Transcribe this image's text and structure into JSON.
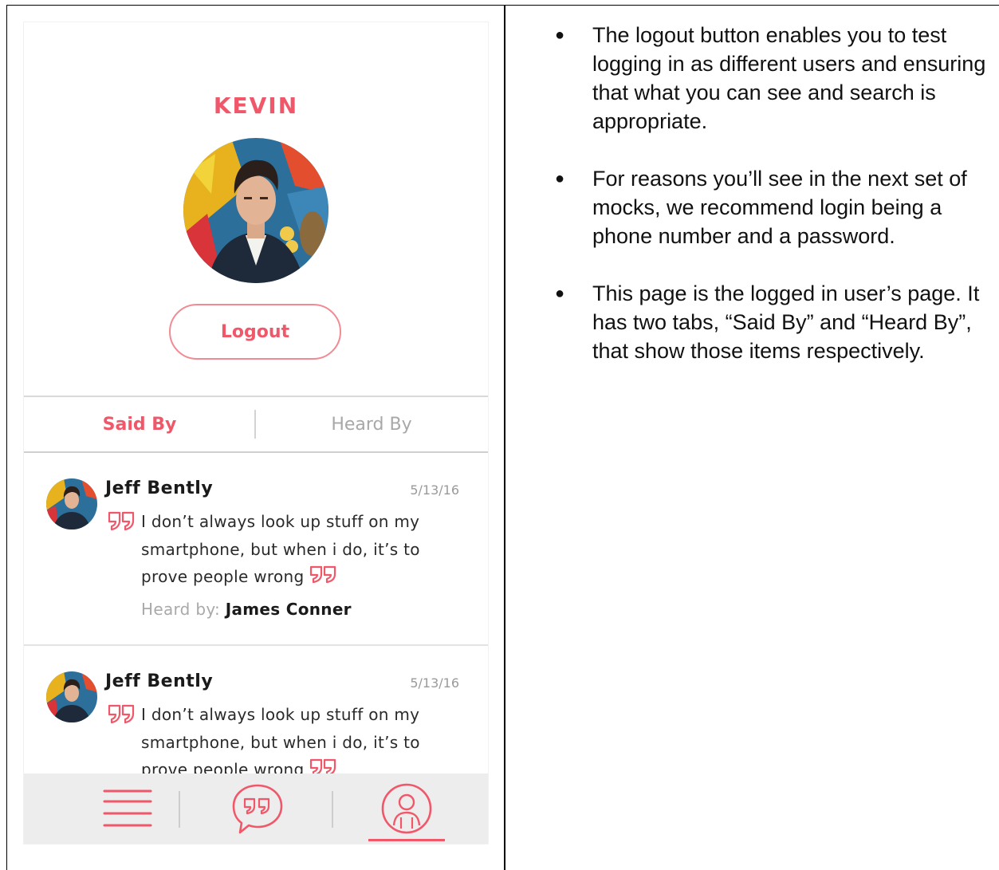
{
  "profile": {
    "name": "KEVIN",
    "logout_label": "Logout"
  },
  "tabs": [
    {
      "label": "Said By",
      "active": true
    },
    {
      "label": "Heard By",
      "active": false
    }
  ],
  "feed": [
    {
      "author": "Jeff Bently",
      "date": "5/13/16",
      "quote": "I don’t always look up stuff on my smartphone, but when i do, it’s to prove people wrong",
      "heard_by_label": "Heard by:",
      "heard_by_name": "James Conner"
    },
    {
      "author": "Jeff Bently",
      "date": "5/13/16",
      "quote": "I don’t always look up stuff on my smartphone, but when i do, it’s to prove people wrong"
    }
  ],
  "bottom_nav": {
    "items": [
      "menu-icon",
      "quote-bubble-icon",
      "profile-icon"
    ],
    "active_index": 2
  },
  "colors": {
    "accent": "#f0586a",
    "nav_bg": "#ededed",
    "muted_text": "#a8a8a8"
  },
  "notes": [
    "The logout button enables you to test logging in as different users and ensuring that what you can see and search is appropriate.",
    "For reasons you’ll see in the next set of mocks, we recommend login being a phone number and a password.",
    "This page is the logged in user’s page. It has two tabs, “Said By” and “Heard By”, that show those items respectively."
  ]
}
